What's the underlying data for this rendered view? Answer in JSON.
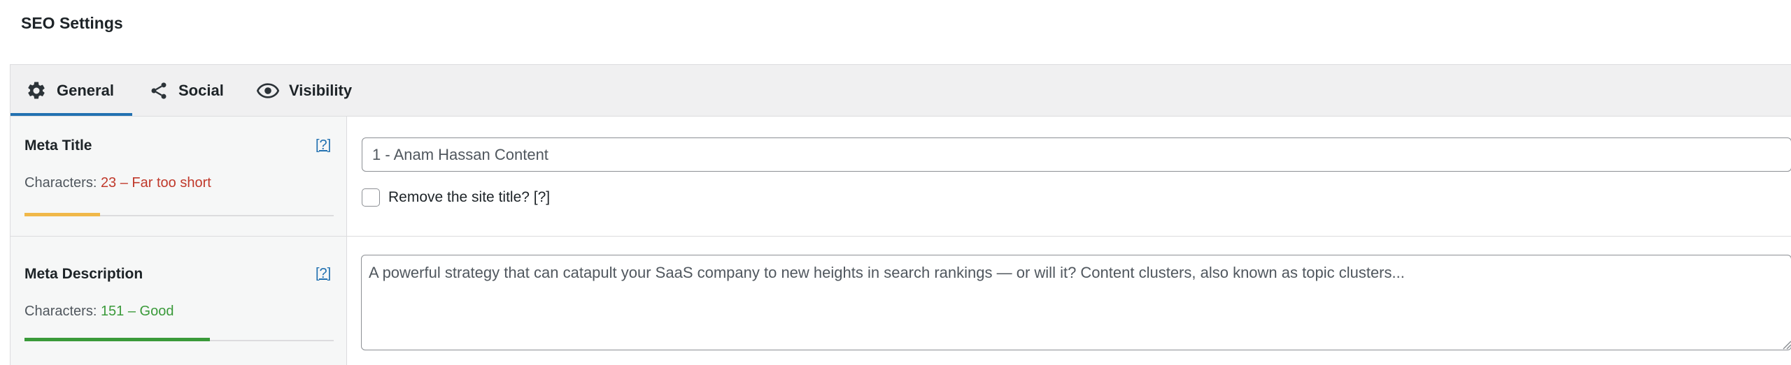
{
  "header": {
    "title": "SEO Settings"
  },
  "tabs": [
    {
      "id": "general",
      "label": "General",
      "icon": "gear-icon",
      "active": true
    },
    {
      "id": "social",
      "label": "Social",
      "icon": "share-icon",
      "active": false
    },
    {
      "id": "visibility",
      "label": "Visibility",
      "icon": "eye-icon",
      "active": false
    }
  ],
  "meta_title": {
    "label": "Meta Title",
    "help": "[?]",
    "chars_prefix": "Characters: ",
    "chars_status": "23 – Far too short",
    "progress_fraction": 0.245,
    "progress_color": "#f0b849",
    "value": "1 - Anam Hassan Content",
    "remove_site_title_label": "Remove the site title? [?]",
    "remove_site_title_checked": false
  },
  "meta_description": {
    "label": "Meta Description",
    "help": "[?]",
    "chars_prefix": "Characters: ",
    "chars_status": "151 – Good",
    "progress_fraction": 0.6,
    "progress_color": "#3a9a3a",
    "value": "A powerful strategy that can catapult your SaaS company to new heights in search rankings — or will it? Content clusters, also known as topic clusters..."
  },
  "colors": {
    "accent": "#2271b1",
    "bad": "#c0392b",
    "good": "#3a9a3a"
  }
}
